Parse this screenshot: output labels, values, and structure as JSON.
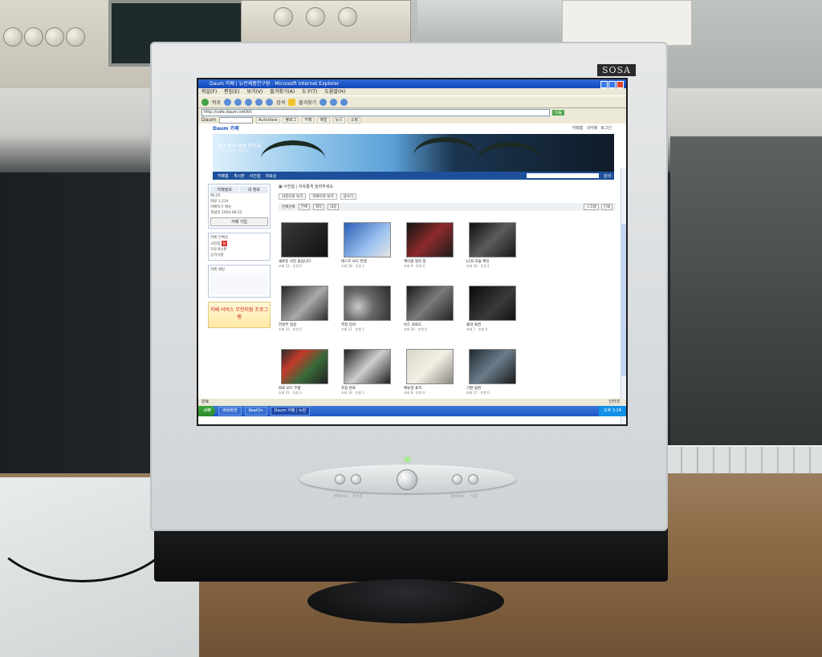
{
  "scene": {
    "monitor_brand": "SOSA",
    "front_buttons": [
      "Menu",
      "Exit",
      "Down",
      "Up"
    ]
  },
  "browser": {
    "window_title": "Daum 카페 | 뉴런제품연구원 - Microsoft Internet Explorer",
    "menu": [
      "파일(F)",
      "편집(E)",
      "보기(V)",
      "즐겨찾기(A)",
      "도구(T)",
      "도움말(H)"
    ],
    "toolbar": [
      "뒤로",
      "검색",
      "즐겨찾기"
    ],
    "address": "http://cafe.daum.net/kit",
    "go_label": "이동",
    "links_bar": [
      "Daum",
      "AutoView",
      "블로그",
      "카페",
      "메일",
      "뉴스",
      "쇼핑"
    ]
  },
  "cafe": {
    "top_brand": "Daum 카페",
    "top_links": [
      "카페홈",
      "내카페",
      "로그인"
    ],
    "banner_title": "Kit 자작 제품 연구회",
    "banner_subtitle": "cafe.daum.net/kit",
    "nav_items": [
      "카페홈",
      "게시판",
      "사진첩",
      "자료실"
    ],
    "nav_search_btn": "검색",
    "left_tabs": [
      "카페정보",
      "내 정보"
    ],
    "left_info_lines": [
      "매니저",
      "회원 1,234",
      "카페지기 메뉴",
      "개설일 2004.08.22"
    ],
    "join_label": "카페 가입",
    "left_menu": [
      "카페 전체글",
      "사진첩",
      "자유게시판",
      "공지사항"
    ],
    "left_side_title": "카페 채팅",
    "left_ad_text": "카페 서비스 무한지원 프로그램",
    "crumb": "▣ 사진첩 | 자유롭게 올려주세요",
    "view_buttons": [
      "사진으로 보기",
      "목록으로 보기",
      "글쓰기"
    ],
    "filter_label": "전체선택",
    "filter_options": [
      "전체",
      "제목",
      "내용"
    ],
    "filter_right": [
      "스크랩",
      "인쇄"
    ],
    "thumbs": [
      {
        "caption": "새로운 사진 올립니다",
        "meta": "조회 12 · 추천 0"
      },
      {
        "caption": "테스트 보드 연결",
        "meta": "조회 18 · 추천 1"
      },
      {
        "caption": "케이블 정리 중",
        "meta": "조회 9 · 추천 0"
      },
      {
        "caption": "LCD 모듈 확인",
        "meta": "조회 22 · 추천 2"
      },
      {
        "caption": "전원부 점검",
        "meta": "조회 15 · 추천 0"
      },
      {
        "caption": "측정 장비",
        "meta": "조회 11 · 추천 1"
      },
      {
        "caption": "보드 회로도",
        "meta": "조회 20 · 추천 0"
      },
      {
        "caption": "출력 화면",
        "meta": "조회 7 · 추천 0"
      },
      {
        "caption": "회로 보드 부품",
        "meta": "조회 31 · 추천 3"
      },
      {
        "caption": "조립 완료",
        "meta": "조회 14 · 추천 1"
      },
      {
        "caption": "매뉴얼 표지",
        "meta": "조회 8 · 추천 0"
      },
      {
        "caption": "기판 뒷면",
        "meta": "조회 17 · 추천 0"
      }
    ]
  },
  "status": {
    "text": "완료",
    "zone": "인터넷"
  },
  "taskbar": {
    "start": "시작",
    "items": [
      "바탕화면",
      "RealOn",
      "Daum 카페 | 뉴런"
    ],
    "tray_time": "오후 3:24"
  }
}
